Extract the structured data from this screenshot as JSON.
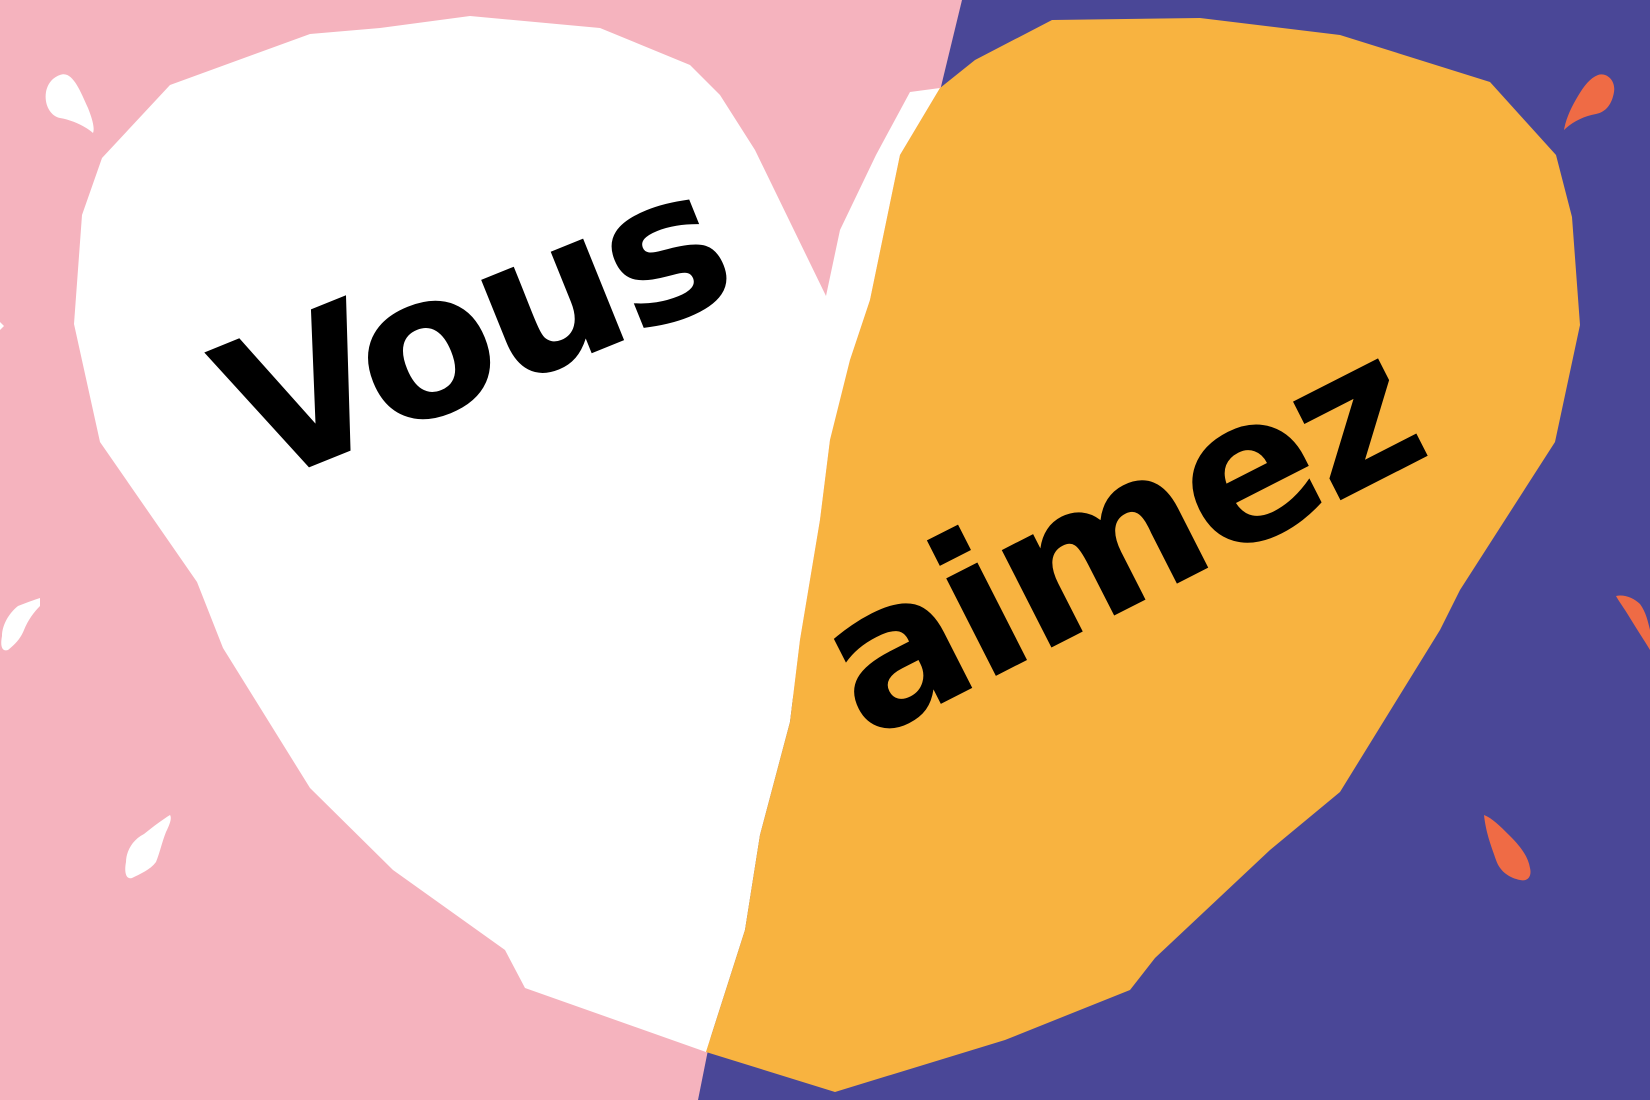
{
  "headline": {
    "word_left": "Vous",
    "word_right": "aimez"
  },
  "colors": {
    "background_left": "#f5b3be",
    "background_right": "#4a4797",
    "heart_left": "#ffffff",
    "heart_right": "#f8b340",
    "text": "#000000",
    "accent_drops_right": "#ef6b45",
    "accent_drops_left": "#ffffff"
  }
}
